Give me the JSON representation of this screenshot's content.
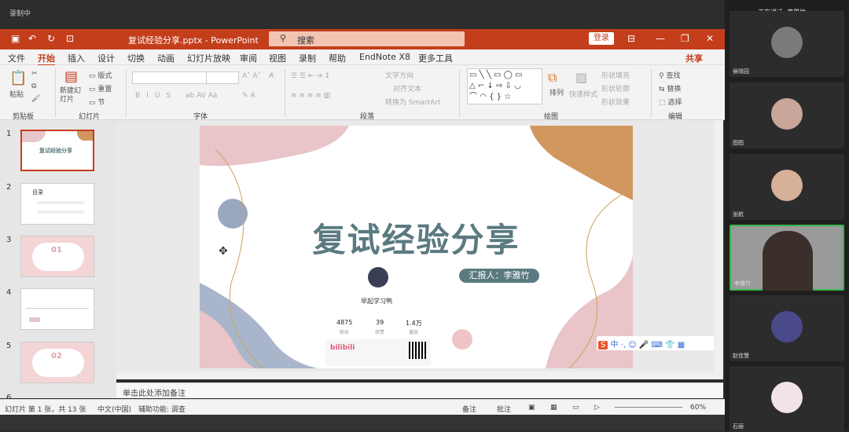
{
  "recording": {
    "label": "录制中"
  },
  "titlebar": {
    "filename": "复试经验分享.pptx - PowerPoint",
    "search_placeholder": "搜索",
    "login": "登录"
  },
  "menu": [
    "文件",
    "开始",
    "插入",
    "设计",
    "切换",
    "动画",
    "幻灯片放映",
    "审阅",
    "视图",
    "录制",
    "帮助",
    "EndNote X8",
    "更多工具"
  ],
  "share": "共享",
  "ribbon": {
    "groups": [
      "剪贴板",
      "幻灯片",
      "字体",
      "段落",
      "绘图",
      "编辑"
    ],
    "paste": "粘贴",
    "new_slide": "新建幻灯片",
    "layout": "版式",
    "reset": "重置",
    "section": "节",
    "text_direction": "文字方向",
    "align_text": "对齐文本",
    "smartart": "转换为 SmartArt",
    "arrange": "排列",
    "quick_styles": "快速样式",
    "shape_fill": "形状填充",
    "shape_outline": "形状轮廓",
    "shape_effects": "形状效果",
    "find": "查找",
    "replace": "替换",
    "select": "选择"
  },
  "slides": [
    "1",
    "2",
    "3",
    "4",
    "5",
    "6"
  ],
  "thumbs": {
    "t1": "复试经验分享",
    "t2": "目录",
    "t3": "01",
    "t5": "02"
  },
  "slide": {
    "title": "复试经验分享",
    "reporter": "汇报人：李雅竹",
    "account": "早起学习鸭",
    "stats": [
      {
        "v": "4875",
        "l": "粉丝"
      },
      {
        "v": "39",
        "l": "获赞"
      },
      {
        "v": "1.4万",
        "l": "播放"
      }
    ],
    "logo": "bilibili"
  },
  "notes_placeholder": "单击此处添加备注",
  "status": {
    "slide_info": "幻灯片 第 1 张，共 13 张",
    "lang": "中文(中国)",
    "accessibility": "辅助功能: 调查",
    "notes": "备注",
    "comments": "批注",
    "zoom": "60%"
  },
  "meeting": {
    "speaking": "正在讲话: 李雅竹",
    "participants": [
      "侯晓园",
      "图图",
      "张航",
      "李雅竹",
      "赵佳慧",
      "石丽"
    ]
  },
  "colors": {
    "accent": "#c43e1c",
    "slide_title": "#5a7a80",
    "reporter_bg": "#5a7a80"
  }
}
